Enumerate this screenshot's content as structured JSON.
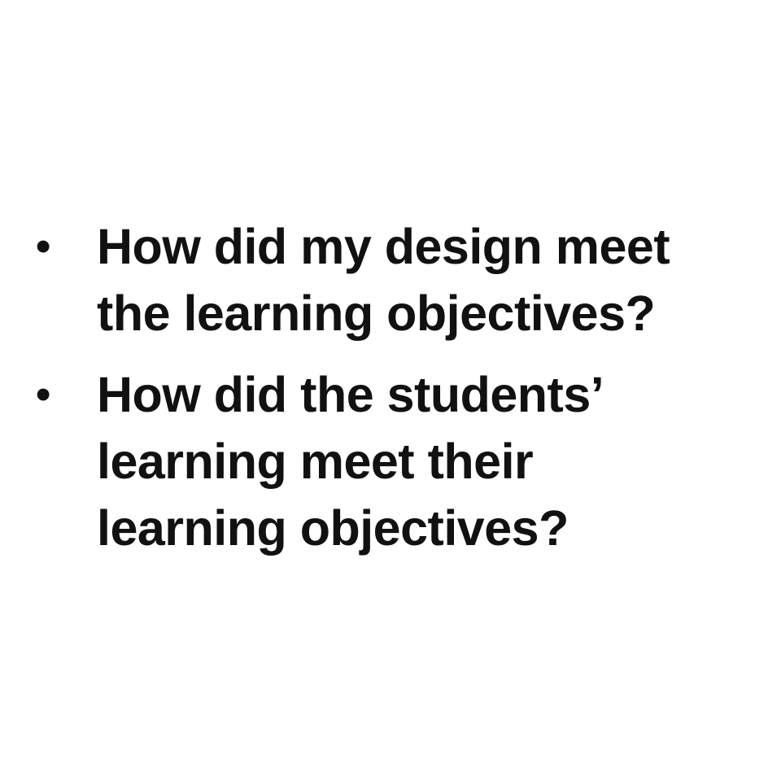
{
  "slide": {
    "bullets": [
      {
        "marker": "•",
        "text": "How did my design meet\nthe learning objectives?"
      },
      {
        "marker": "•",
        "text": "How did the students’\nlearning meet their\nlearning objectives?"
      }
    ]
  }
}
